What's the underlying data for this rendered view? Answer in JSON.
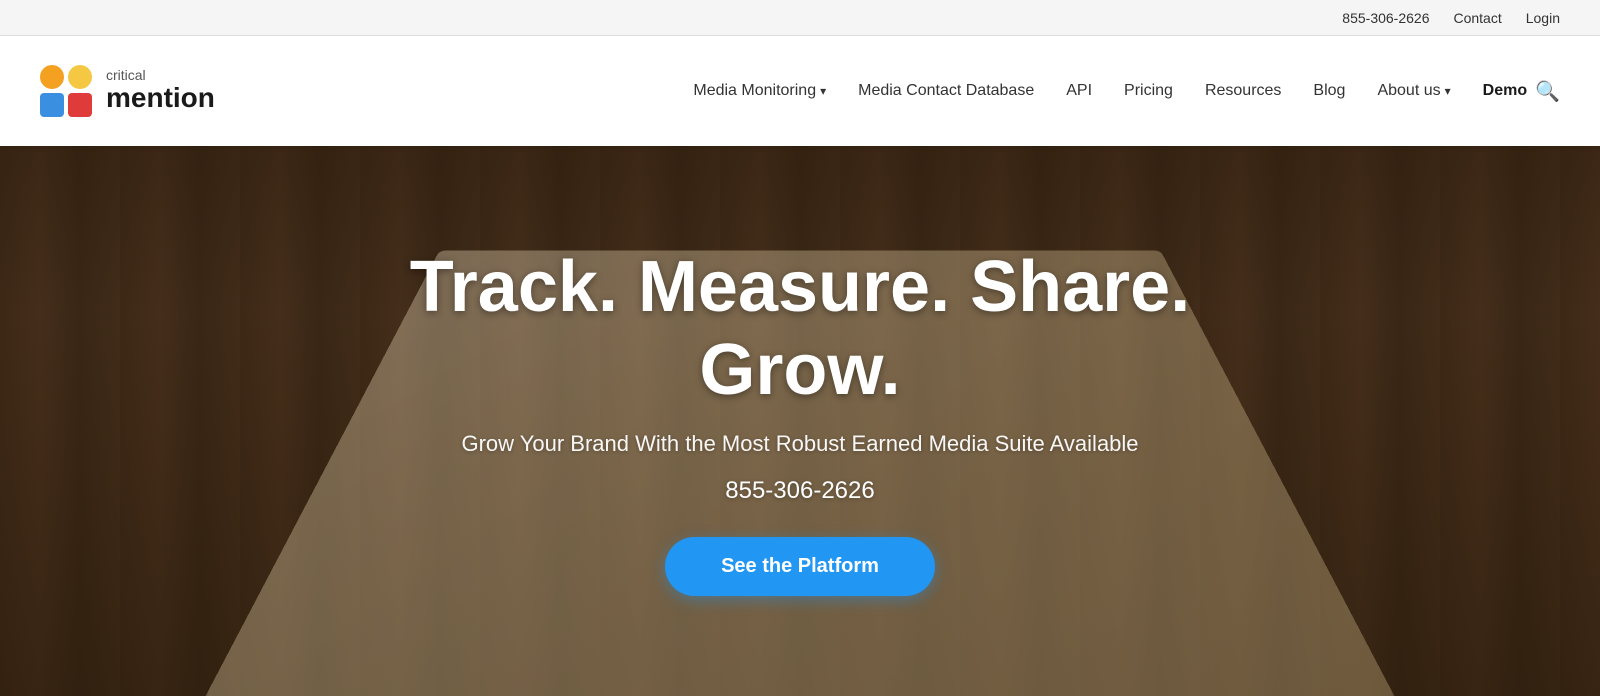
{
  "topbar": {
    "phone": "855-306-2626",
    "contact": "Contact",
    "login": "Login"
  },
  "logo": {
    "critical": "critical",
    "mention": "mention",
    "dots": [
      {
        "color": "#F4A020",
        "shape": "circle"
      },
      {
        "color": "#F4C842",
        "shape": "circle"
      },
      {
        "color": "#3B8FE0",
        "shape": "square"
      },
      {
        "color": "#E03B3B",
        "shape": "square"
      }
    ]
  },
  "nav": {
    "items": [
      {
        "label": "Media Monitoring",
        "dropdown": true,
        "id": "media-monitoring"
      },
      {
        "label": "Media Contact Database",
        "dropdown": false,
        "id": "media-contact-db"
      },
      {
        "label": "API",
        "dropdown": false,
        "id": "api"
      },
      {
        "label": "Pricing",
        "dropdown": false,
        "id": "pricing"
      },
      {
        "label": "Resources",
        "dropdown": false,
        "id": "resources"
      },
      {
        "label": "Blog",
        "dropdown": false,
        "id": "blog"
      },
      {
        "label": "About us",
        "dropdown": true,
        "id": "about-us"
      },
      {
        "label": "Demo",
        "dropdown": false,
        "id": "demo"
      }
    ]
  },
  "hero": {
    "headline_line1": "Track. Measure. Share.",
    "headline_line2": "Grow.",
    "subtitle": "Grow Your Brand With the Most Robust Earned Media Suite Available",
    "phone": "855-306-2626",
    "cta_button": "See the Platform"
  }
}
